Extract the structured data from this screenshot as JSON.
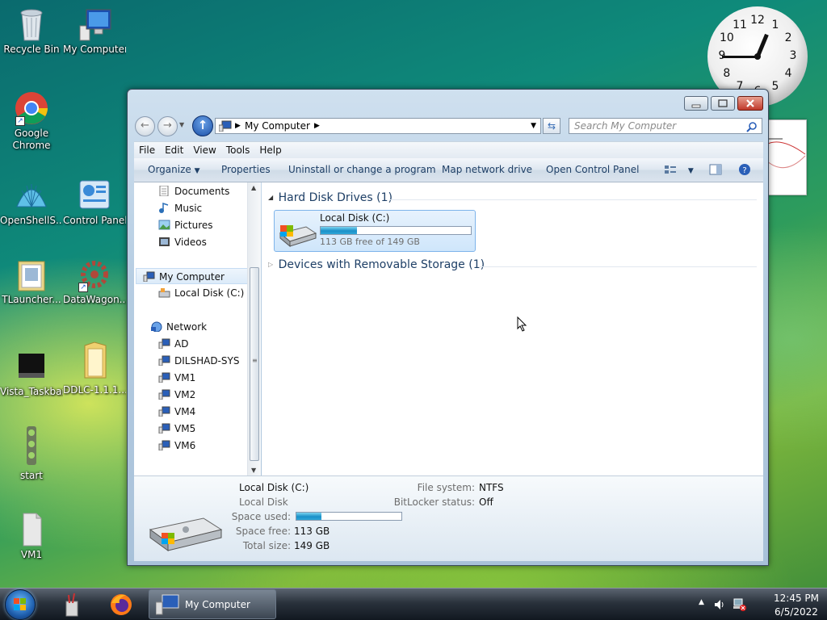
{
  "desktop": {
    "icons": [
      {
        "label": "Recycle Bin"
      },
      {
        "label": "My Computer"
      },
      {
        "label": "Google Chrome"
      },
      {
        "label": "OpenShellS..."
      },
      {
        "label": "Control Panel"
      },
      {
        "label": "TLauncher..."
      },
      {
        "label": "DataWagon..."
      },
      {
        "label": "Vista_Taskbar"
      },
      {
        "label": "DDLC-1.1.1..."
      },
      {
        "label": "start"
      },
      {
        "label": "VM1"
      }
    ]
  },
  "clock": {
    "numerals": [
      "12",
      "1",
      "2",
      "3",
      "4",
      "5",
      "6",
      "7",
      "8",
      "9",
      "10",
      "11"
    ],
    "hour": 12,
    "minute": 45
  },
  "window": {
    "address": {
      "path": "My Computer"
    },
    "search": {
      "placeholder": "Search My Computer"
    },
    "menu": [
      "File",
      "Edit",
      "View",
      "Tools",
      "Help"
    ],
    "toolbar": {
      "organize": "Organize",
      "properties": "Properties",
      "uninstall": "Uninstall or change a program",
      "map_drive": "Map network drive",
      "control_panel": "Open Control Panel"
    },
    "nav_pane": {
      "libraries": [
        "Documents",
        "Music",
        "Pictures",
        "Videos"
      ],
      "computer": "My Computer",
      "local_disk": "Local Disk (C:)",
      "network": "Network",
      "network_items": [
        "AD",
        "DILSHAD-SYS",
        "VM1",
        "VM2",
        "VM4",
        "VM5",
        "VM6"
      ]
    },
    "content": {
      "hard_disk_group": "Hard Disk Drives (1)",
      "drive": {
        "name": "Local Disk (C:)",
        "free_text": "113 GB free of 149 GB",
        "used_fraction": 0.24
      },
      "removable_group": "Devices with Removable Storage (1)"
    },
    "details": {
      "name": "Local Disk (C:)",
      "type": "Local Disk",
      "space_used_label": "Space used:",
      "space_free_label": "Space free:",
      "space_free": "113 GB",
      "total_size_label": "Total size:",
      "total_size": "149 GB",
      "fs_label": "File system:",
      "fs": "NTFS",
      "bitlocker_label": "BitLocker status:",
      "bitlocker": "Off"
    }
  },
  "taskbar": {
    "active_window": "My Computer",
    "time": "12:45 PM",
    "date": "6/5/2022"
  }
}
